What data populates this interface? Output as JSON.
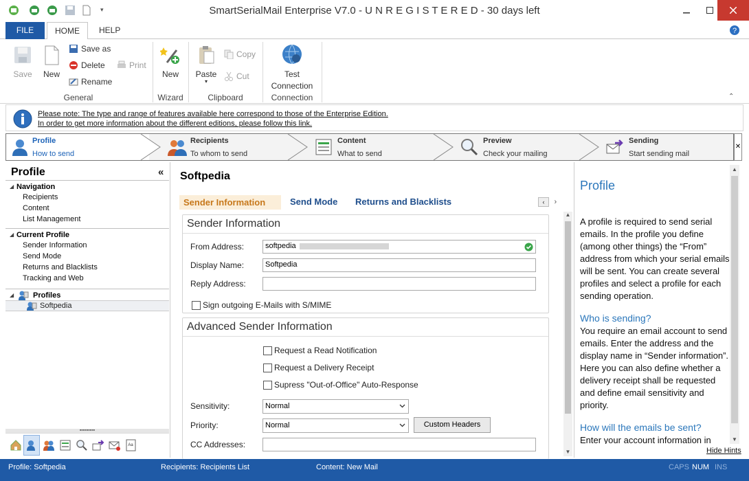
{
  "window": {
    "title": "SmartSerialMail Enterprise V7.0 - U N R E G I S T E R E D - 30 days left"
  },
  "ribbon_tabs": {
    "file": "FILE",
    "home": "HOME",
    "help": "HELP"
  },
  "ribbon": {
    "general": {
      "label": "General",
      "save": "Save",
      "new": "New",
      "save_as": "Save as",
      "delete": "Delete",
      "rename": "Rename",
      "print": "Print"
    },
    "wizard": {
      "label": "Wizard",
      "new": "New"
    },
    "clipboard": {
      "label": "Clipboard",
      "paste": "Paste",
      "copy": "Copy",
      "cut": "Cut"
    },
    "connection": {
      "label": "Connection",
      "test_line1": "Test",
      "test_line2": "Connection"
    }
  },
  "infobar": {
    "line1": "Please note: The type and range of features available here correspond to those of the Enterprise Edition.",
    "line2": "In order to get more information about the different editions, please follow this link."
  },
  "steps": [
    {
      "title": "Profile",
      "subtitle": "How to send"
    },
    {
      "title": "Recipients",
      "subtitle": "To whom to send"
    },
    {
      "title": "Content",
      "subtitle": "What to send"
    },
    {
      "title": "Preview",
      "subtitle": "Check your mailing"
    },
    {
      "title": "Sending",
      "subtitle": "Start sending mail"
    }
  ],
  "left_panel": {
    "title": "Profile",
    "navigation": {
      "title": "Navigation",
      "items": [
        "Recipients",
        "Content",
        "List Management"
      ]
    },
    "current_profile": {
      "title": "Current Profile",
      "items": [
        "Sender Information",
        "Send Mode",
        "Returns and Blacklists",
        "Tracking and Web"
      ]
    },
    "profiles": {
      "title": "Profiles",
      "items": [
        "Softpedia"
      ]
    }
  },
  "center": {
    "title": "Softpedia",
    "tabs": [
      "Sender Information",
      "Send Mode",
      "Returns and Blacklists"
    ],
    "sender_info": {
      "title": "Sender Information",
      "from_label": "From Address:",
      "from_value": "softpedia",
      "display_label": "Display Name:",
      "display_value": "Softpedia",
      "reply_label": "Reply Address:",
      "reply_value": "",
      "smime_label": "Sign outgoing E-Mails with S/MIME"
    },
    "advanced": {
      "title": "Advanced Sender Information",
      "read_notification": "Request a Read Notification",
      "delivery_receipt": "Request a Delivery Receipt",
      "suppress_ooo": "Supress \"Out-of-Office\" Auto-Response",
      "sensitivity_label": "Sensitivity:",
      "sensitivity_value": "Normal",
      "priority_label": "Priority:",
      "priority_value": "Normal",
      "custom_headers": "Custom Headers",
      "cc_label": "CC Addresses:",
      "cc_value": ""
    }
  },
  "hints": {
    "title": "Profile",
    "p1": "A profile is required to send serial emails. In the profile you define (among other things) the “From” address from which your serial emails will be sent. You can create several profiles and select a profile for each sending operation.",
    "h2": "Who is sending?",
    "p2": "You require an email account to send emails. Enter the address and the display name in “Sender information”. Here you can also define whether a delivery receipt shall be requested and define email sensitivity and priority.",
    "h3": "How will the emails be sent?",
    "p3": "Enter your account information in",
    "hide": "Hide Hints"
  },
  "status": {
    "profile": "Profile: Softpedia",
    "recipients": "Recipients: Recipients List",
    "content": "Content: New Mail",
    "caps": "CAPS",
    "num": "NUM",
    "ins": "INS"
  },
  "colors": {
    "accent": "#1f5aa6",
    "link_blue": "#2b77bb",
    "active_tab": "#c7781b",
    "close_red": "#c7392f"
  }
}
